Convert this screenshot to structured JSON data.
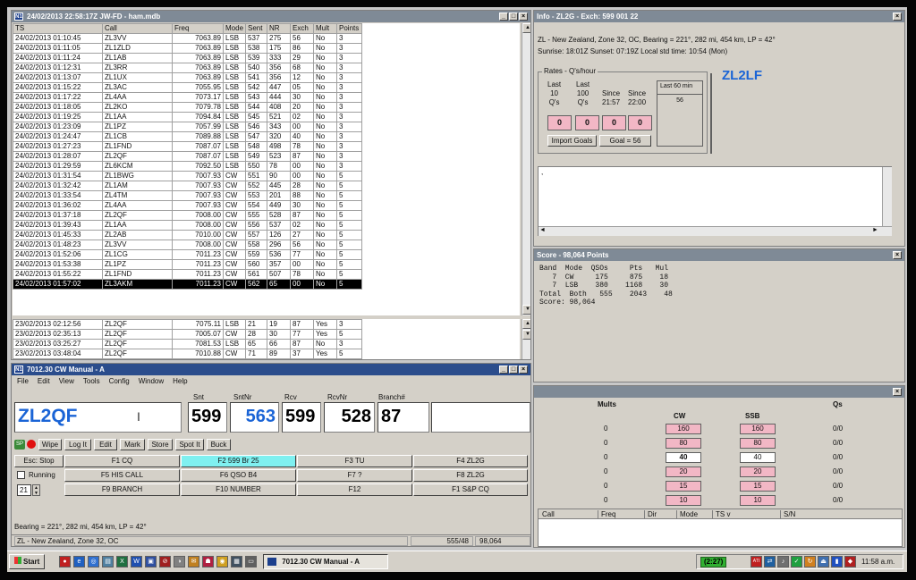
{
  "log_window": {
    "title": "24/02/2013 22:58:17Z  JW-FD - ham.mdb",
    "columns": [
      "TS",
      "Call",
      "Freq",
      "Mode",
      "Sent",
      "NR",
      "Exch",
      "Mult",
      "Points"
    ],
    "rows": [
      [
        "24/02/2013 01:10:45",
        "ZL3VV",
        "7063.89",
        "LSB",
        "537",
        "275",
        "56",
        "No",
        "3"
      ],
      [
        "24/02/2013 01:11:05",
        "ZL1ZLD",
        "7063.89",
        "LSB",
        "538",
        "175",
        "86",
        "No",
        "3"
      ],
      [
        "24/02/2013 01:11:24",
        "ZL1AB",
        "7063.89",
        "LSB",
        "539",
        "333",
        "29",
        "No",
        "3"
      ],
      [
        "24/02/2013 01:12:31",
        "ZL3RR",
        "7063.89",
        "LSB",
        "540",
        "356",
        "68",
        "No",
        "3"
      ],
      [
        "24/02/2013 01:13:07",
        "ZL1UX",
        "7063.89",
        "LSB",
        "541",
        "356",
        "12",
        "No",
        "3"
      ],
      [
        "24/02/2013 01:15:22",
        "ZL3AC",
        "7055.95",
        "LSB",
        "542",
        "447",
        "05",
        "No",
        "3"
      ],
      [
        "24/02/2013 01:17:22",
        "ZL4AA",
        "7073.17",
        "LSB",
        "543",
        "444",
        "30",
        "No",
        "3"
      ],
      [
        "24/02/2013 01:18:05",
        "ZL2KO",
        "7079.78",
        "LSB",
        "544",
        "408",
        "20",
        "No",
        "3"
      ],
      [
        "24/02/2013 01:19:25",
        "ZL1AA",
        "7094.84",
        "LSB",
        "545",
        "521",
        "02",
        "No",
        "3"
      ],
      [
        "24/02/2013 01:23:09",
        "ZL1PZ",
        "7057.99",
        "LSB",
        "546",
        "343",
        "00",
        "No",
        "3"
      ],
      [
        "24/02/2013 01:24:47",
        "ZL1CB",
        "7089.88",
        "LSB",
        "547",
        "320",
        "40",
        "No",
        "3"
      ],
      [
        "24/02/2013 01:27:23",
        "ZL1FND",
        "7087.07",
        "LSB",
        "548",
        "498",
        "78",
        "No",
        "3"
      ],
      [
        "24/02/2013 01:28:07",
        "ZL2QF",
        "7087.07",
        "LSB",
        "549",
        "523",
        "87",
        "No",
        "3"
      ],
      [
        "24/02/2013 01:29:59",
        "ZL6KCM",
        "7092.50",
        "LSB",
        "550",
        "78",
        "00",
        "No",
        "3"
      ],
      [
        "24/02/2013 01:31:54",
        "ZL1BWG",
        "7007.93",
        "CW",
        "551",
        "90",
        "00",
        "No",
        "5"
      ],
      [
        "24/02/2013 01:32:42",
        "ZL1AM",
        "7007.93",
        "CW",
        "552",
        "445",
        "28",
        "No",
        "5"
      ],
      [
        "24/02/2013 01:33:54",
        "ZL4TM",
        "7007.93",
        "CW",
        "553",
        "201",
        "88",
        "No",
        "5"
      ],
      [
        "24/02/2013 01:36:02",
        "ZL4AA",
        "7007.93",
        "CW",
        "554",
        "449",
        "30",
        "No",
        "5"
      ],
      [
        "24/02/2013 01:37:18",
        "ZL2QF",
        "7008.00",
        "CW",
        "555",
        "528",
        "87",
        "No",
        "5"
      ],
      [
        "24/02/2013 01:39:43",
        "ZL1AA",
        "7008.00",
        "CW",
        "556",
        "537",
        "02",
        "No",
        "5"
      ],
      [
        "24/02/2013 01:45:33",
        "ZL2AB",
        "7010.00",
        "CW",
        "557",
        "126",
        "27",
        "No",
        "5"
      ],
      [
        "24/02/2013 01:48:23",
        "ZL3VV",
        "7008.00",
        "CW",
        "558",
        "296",
        "56",
        "No",
        "5"
      ],
      [
        "24/02/2013 01:52:06",
        "ZL1CG",
        "7011.23",
        "CW",
        "559",
        "536",
        "77",
        "No",
        "5"
      ],
      [
        "24/02/2013 01:53:38",
        "ZL1PZ",
        "7011.23",
        "CW",
        "560",
        "357",
        "00",
        "No",
        "5"
      ],
      [
        "24/02/2013 01:55:22",
        "ZL1FND",
        "7011.23",
        "CW",
        "561",
        "507",
        "78",
        "No",
        "5"
      ],
      [
        "24/02/2013 01:57:02",
        "ZL3AKM",
        "7011.23",
        "CW",
        "562",
        "65",
        "00",
        "No",
        "5"
      ]
    ],
    "dupe_rows": [
      [
        "23/02/2013 02:12:56",
        "ZL2QF",
        "7075.11",
        "LSB",
        "21",
        "19",
        "87",
        "Yes",
        "3"
      ],
      [
        "23/02/2013 02:35:13",
        "ZL2QF",
        "7005.07",
        "CW",
        "28",
        "30",
        "77",
        "Yes",
        "5"
      ],
      [
        "23/02/2013 03:25:27",
        "ZL2QF",
        "7081.53",
        "LSB",
        "65",
        "66",
        "87",
        "No",
        "3"
      ],
      [
        "23/02/2013 03:48:04",
        "ZL2QF",
        "7010.88",
        "CW",
        "71",
        "89",
        "37",
        "Yes",
        "5"
      ]
    ]
  },
  "entry_window": {
    "title": "7012.30 CW Manual - A",
    "menu": [
      "File",
      "Edit",
      "View",
      "Tools",
      "Config",
      "Window",
      "Help"
    ],
    "labels": {
      "snt": "Snt",
      "sntnr": "SntNr",
      "rcv": "Rcv",
      "rcvnr": "RcvNr",
      "branch": "Branch#"
    },
    "call": "ZL2QF",
    "snt": "599",
    "sntnr": "563",
    "rcv": "599",
    "rcvnr": "528",
    "branch": "87",
    "sp_label": "SP",
    "actions": [
      "Wipe",
      "Log It",
      "Edit",
      "Mark",
      "Store",
      "Spot It",
      "Buck"
    ],
    "fkeys": {
      "esc": "Esc: Stop",
      "f1": "F1 CQ",
      "f2": "F2 599  Br 25",
      "f3": "F3 TU",
      "f4": "F4 ZL2G",
      "f5": "F5 HIS CALL",
      "f6": "F6 QSO B4",
      "f7": "F7 ?",
      "f8": "F8 ZL2G",
      "f9": "F9 BRANCH",
      "f10": "F10 NUMBER",
      "f12": "F12",
      "f11": "F1 S&P CQ"
    },
    "running_label": "Running",
    "speed": "21",
    "bearing": "Bearing = 221°, 282  mi, 454 km, LP = 42°",
    "status_left": "ZL - New Zealand, Zone 32, OC",
    "status_count": "555/48",
    "status_score": "98,064"
  },
  "info_window": {
    "title": "Info - ZL2G - Exch: 599 001 22",
    "line1": "ZL - New Zealand, Zone 32, OC, Bearing = 221°, 282  mi, 454 km, LP = 42°",
    "line2": "Sunrise: 18:01Z    Sunset: 07:19Z   Local std time: 10:54 (Mon)",
    "rates_label": "Rates - Q's/hour",
    "rate_cols": [
      "Last\n10\nQ's",
      "Last\n100\nQ's",
      "Since\n21:57",
      "Since\n22:00"
    ],
    "rate_vals": [
      "0",
      "0",
      "0",
      "0"
    ],
    "last60_label": "Last 60 min",
    "last60_val": "56",
    "import_goals": "Import Goals",
    "goal": "Goal = 56",
    "call_display": "ZL2LF",
    "note": ","
  },
  "score_window": {
    "title": "Score - 98,064 Points",
    "text": "Band  Mode  QSOs     Pts   Mul\n   7  CW     175     875    18\n   7  LSB    380    1168    30\nTotal  Both   555    2043    48\nScore: 98,064"
  },
  "mults_window": {
    "headers": {
      "mults": "Mults",
      "cw": "CW",
      "ssb": "SSB",
      "qs": "Qs"
    },
    "rows": [
      {
        "count": "0",
        "cw": "160",
        "ssb": "160",
        "qs": "0/0"
      },
      {
        "count": "0",
        "cw": "80",
        "ssb": "80",
        "qs": "0/0"
      },
      {
        "count": "0",
        "cw": "40",
        "ssb": "40",
        "qs": "0/0"
      },
      {
        "count": "0",
        "cw": "20",
        "ssb": "20",
        "qs": "0/0"
      },
      {
        "count": "0",
        "cw": "15",
        "ssb": "15",
        "qs": "0/0"
      },
      {
        "count": "0",
        "cw": "10",
        "ssb": "10",
        "qs": "0/0"
      }
    ],
    "cw_status": [
      "pink",
      "pink",
      "white",
      "pink",
      "pink",
      "pink"
    ],
    "ssb_status": [
      "pink",
      "pink",
      "white",
      "pink",
      "pink",
      "pink"
    ],
    "cols": [
      "Call",
      "Freq",
      "Dir",
      "Mode",
      "TS v",
      "S/N"
    ]
  },
  "taskbar": {
    "start": "Start",
    "task": "7012.30 CW Manual - A",
    "tray_badge": "(2:27)",
    "clock": "11:58 a.m."
  },
  "colors": {
    "title_active": "#2b4d8c",
    "pink": "#f2b7c5",
    "call_blue": "#1a64d6",
    "f2_highlight": "#7ff0f0"
  }
}
